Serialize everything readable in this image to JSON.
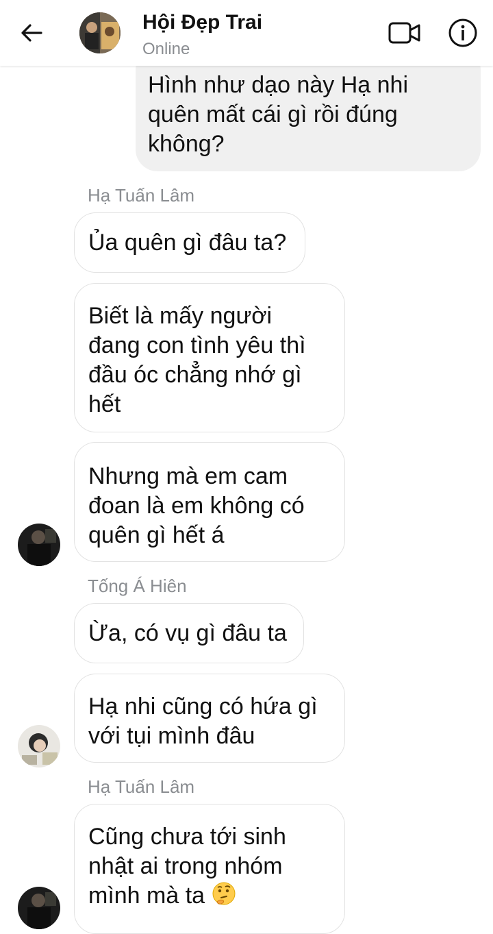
{
  "header": {
    "title": "Hội Đẹp Trai",
    "status": "Online"
  },
  "icons": {
    "back": "arrow-left-icon",
    "video": "video-camera-icon",
    "info": "info-icon"
  },
  "messages": {
    "outgoing_0": "Hình như dạo này Hạ nhi quên mất cái gì rồi đúng không?",
    "group1": {
      "sender": "Hạ Tuấn Lâm",
      "m0": "Ủa quên gì đâu ta?",
      "m1": "Biết là mấy người đang con tình yêu thì đầu óc chẳng nhớ gì hết",
      "m2": "Nhưng mà em cam đoan là em không có quên gì hết á"
    },
    "group2": {
      "sender": "Tống Á Hiên",
      "m0": "Ừa, có vụ gì đâu ta",
      "m1": "Hạ nhi cũng có hứa gì với tụi mình đâu"
    },
    "group3": {
      "sender": "Hạ Tuấn Lâm",
      "m0": "Cũng chưa tới sinh nhật ai trong nhóm mình mà ta",
      "emoji": "thinking-face-emoji"
    }
  },
  "colors": {
    "outgoing_bubble": "#f0f0f0",
    "incoming_border": "#e2e2e2",
    "muted_text": "#8a8d91"
  }
}
